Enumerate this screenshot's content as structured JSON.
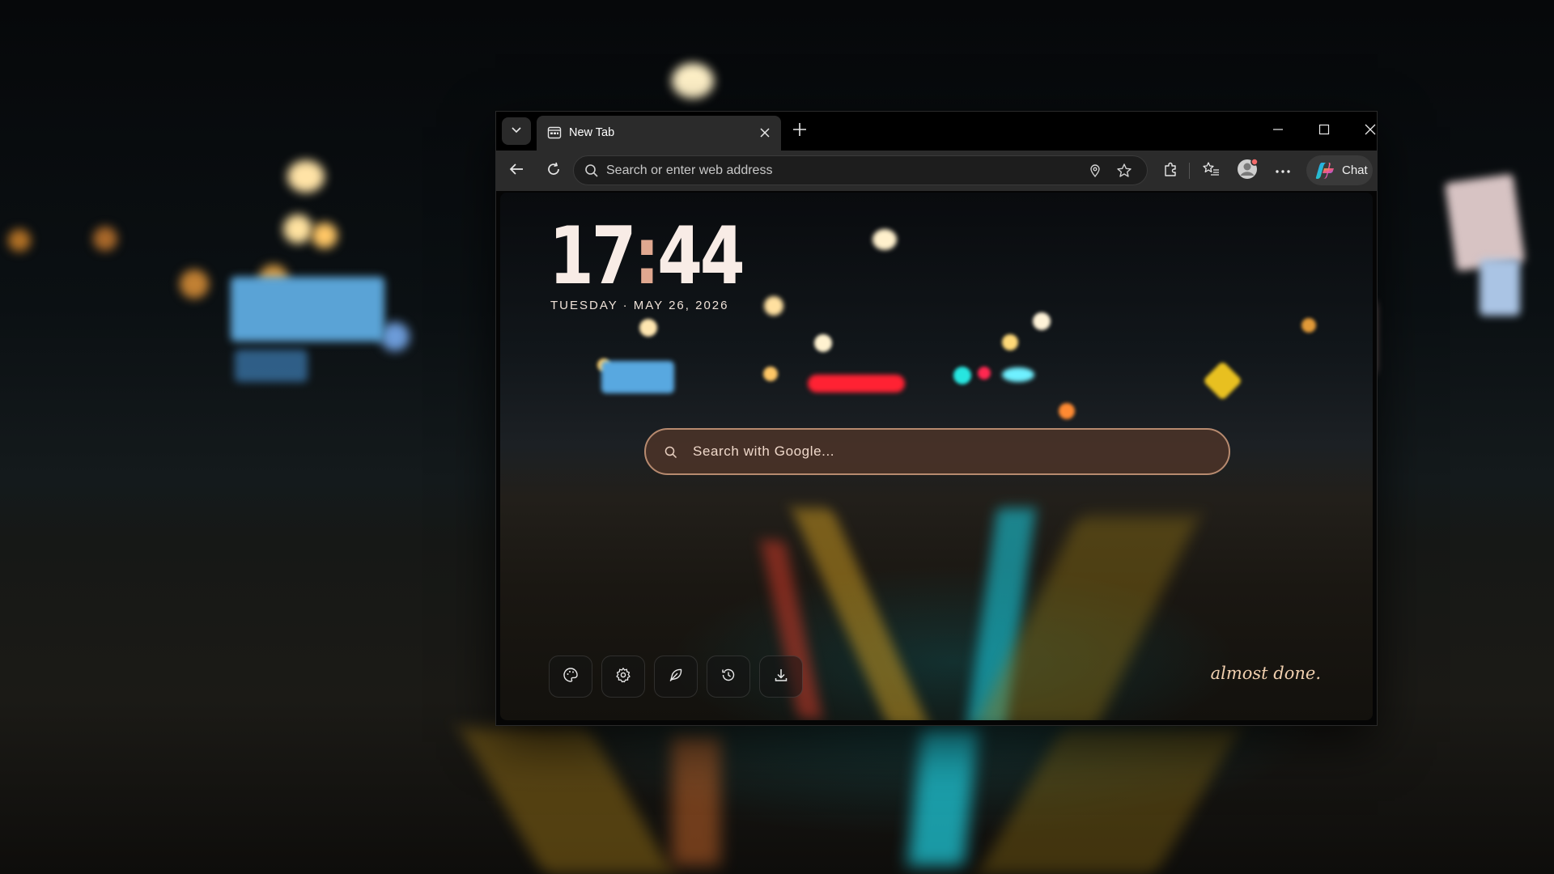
{
  "browser": {
    "tab": {
      "title": "New Tab"
    },
    "address_bar": {
      "placeholder": "Search or enter web address"
    },
    "chat_button": {
      "label": "Chat"
    },
    "icons": {
      "tab_menu": "chevron-down-icon",
      "tab_favicon": "new-tab-page-icon",
      "tab_close": "close-icon",
      "new_tab": "plus-icon",
      "minimize": "minimize-icon",
      "maximize": "maximize-icon",
      "close_window": "close-icon",
      "back": "back-arrow-icon",
      "refresh": "refresh-icon",
      "search": "search-icon",
      "location": "location-pin-icon",
      "favorite": "star-icon",
      "extensions": "puzzle-icon",
      "favorites": "favorites-list-icon",
      "profile": "avatar",
      "more": "more-dots-icon",
      "copilot": "copilot-icon"
    }
  },
  "newtab": {
    "clock": {
      "hours": "17",
      "separator": ":",
      "minutes": "44"
    },
    "date": "TUESDAY · MAY 26, 2026",
    "search": {
      "placeholder": "Search with Google..."
    },
    "dock": [
      {
        "icon": "palette-icon"
      },
      {
        "icon": "gear-icon"
      },
      {
        "icon": "feather-icon"
      },
      {
        "icon": "history-icon"
      },
      {
        "icon": "download-icon"
      }
    ],
    "signature": "almost done."
  },
  "colors": {
    "search_border": "#b78a6f",
    "search_fill": "#4e3428",
    "clock_text": "#f8ece6",
    "signature_text": "#f0cfae"
  }
}
